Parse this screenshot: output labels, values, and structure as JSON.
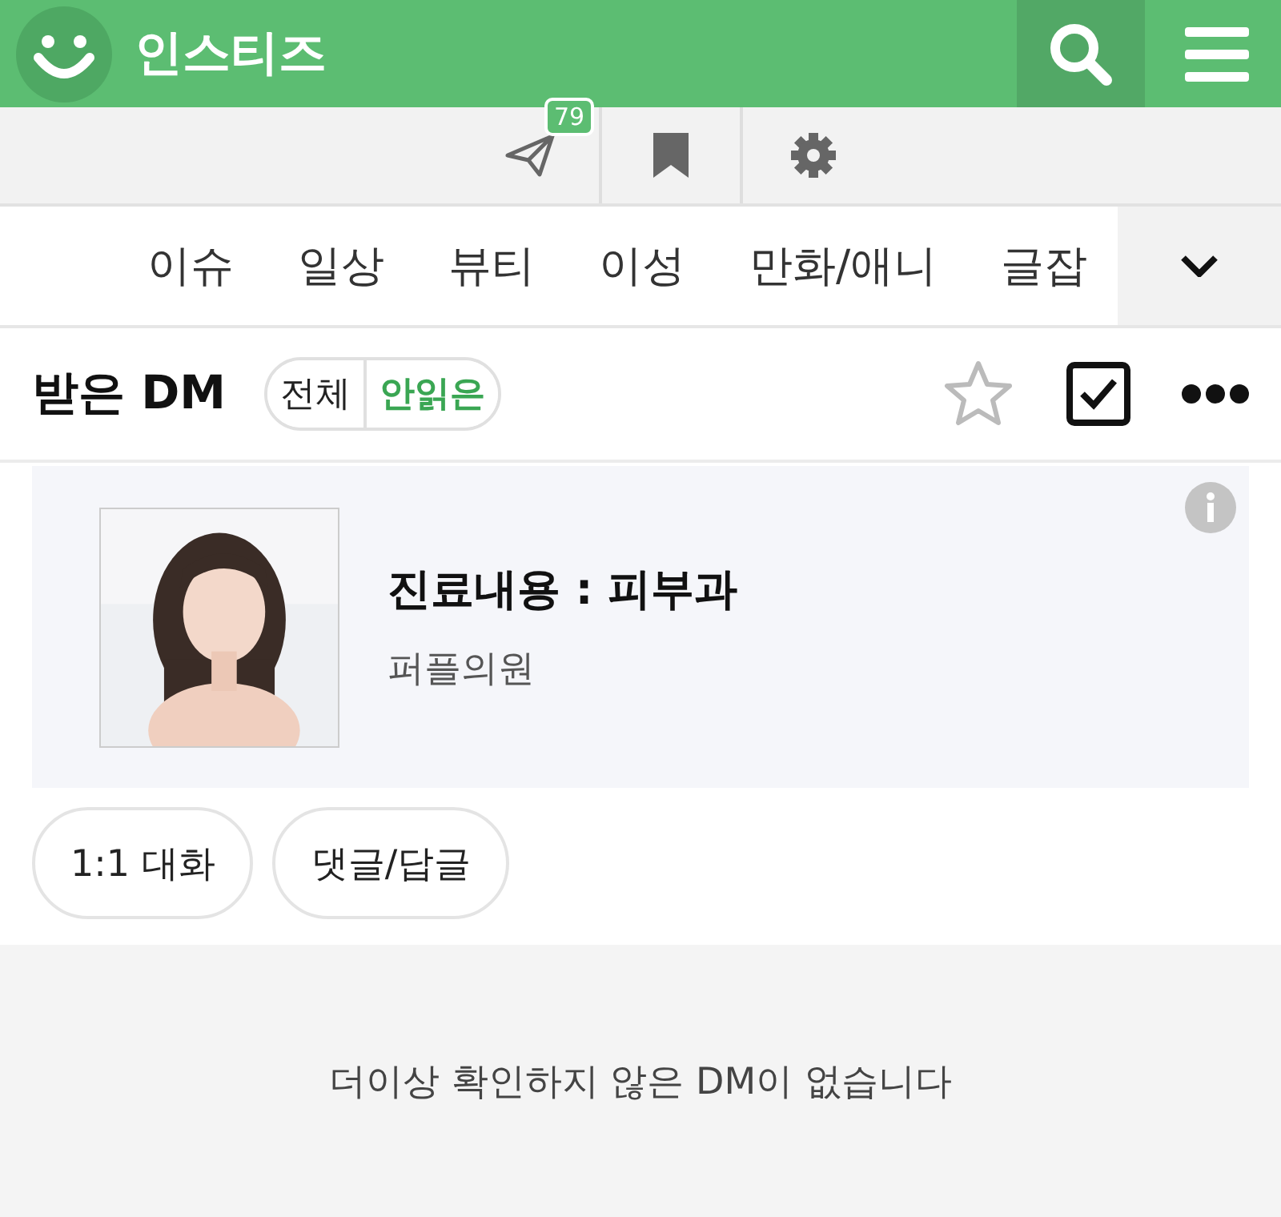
{
  "header": {
    "logo_text": "인스티즈"
  },
  "toolbar": {
    "badge": "79"
  },
  "categories": [
    "이슈",
    "일상",
    "뷰티",
    "이성",
    "만화/애니",
    "글잡"
  ],
  "dm_header": {
    "title": "받은 DM",
    "filters": [
      {
        "label": "전체",
        "selected": false
      },
      {
        "label": "안읽은",
        "selected": true
      }
    ]
  },
  "ad": {
    "title": "진료내용 : 피부과",
    "subtitle": "퍼플의원"
  },
  "buttons": [
    "1:1 대화",
    "댓글/답글"
  ],
  "empty_message": "더이상 확인하지 않은 DM이 없습니다"
}
